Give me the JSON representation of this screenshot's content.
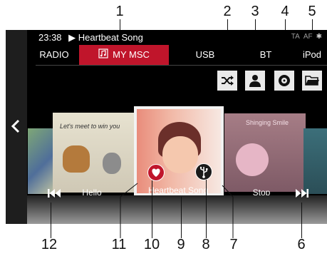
{
  "callouts": [
    "1",
    "2",
    "3",
    "4",
    "5",
    "6",
    "7",
    "8",
    "9",
    "10",
    "11",
    "12"
  ],
  "status": {
    "time": "23:38",
    "track": "▶ Heartbeat Song",
    "indicators": [
      "TA",
      "AF"
    ]
  },
  "tabs": [
    {
      "label": "RADIO"
    },
    {
      "label": "MY MSC",
      "active": true
    },
    {
      "label": "USB"
    },
    {
      "label": "BT"
    },
    {
      "label": "iPod"
    }
  ],
  "controls": [
    "shuffle-icon",
    "artist-icon",
    "album-icon",
    "folder-icon"
  ],
  "albums": [
    {
      "caption": "",
      "art_text": ""
    },
    {
      "caption": "Hello",
      "art_text": "Let's meet to win you"
    },
    {
      "caption": "Heartbeat Song",
      "art_text": ""
    },
    {
      "caption": "Stop",
      "art_text": "Shinging Smile"
    }
  ],
  "colors": {
    "accent": "#c0152b",
    "screen": "#000000",
    "button": "#e9e9e9"
  }
}
